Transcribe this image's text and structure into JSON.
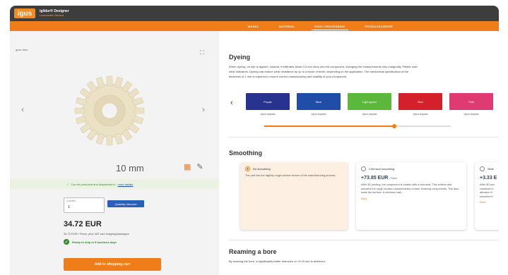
{
  "app": {
    "logo": "igus",
    "title": "iglidur® Designer",
    "subtitle": "Lasersinter-Service"
  },
  "nav": {
    "tabs": [
      {
        "label": "MODEL",
        "active": false
      },
      {
        "label": "MATERIAL",
        "active": false
      },
      {
        "label": "POST-PROCESSING",
        "active": true
      },
      {
        "label": "PRODUCE/ORDER",
        "active": false
      }
    ]
  },
  "viewer": {
    "label": "gear view",
    "size": "10 mm",
    "availability": "Can be produced and dispatched in",
    "availability_link": "more details"
  },
  "order": {
    "quantity_caption": "Quantity",
    "quantity": "1",
    "discount_button": "Quantity discount",
    "price": "34.72 EUR",
    "price_note": "34.72 EUR / Piece, plus VAT and shipping/packages",
    "ship": "Ready to ship in 5 business days",
    "cart_button": "Add to shopping cart"
  },
  "dyeing": {
    "heading": "Dyeing",
    "text_lines": [
      "When dyeing, no dye is applied. Instead, it infiltrates about 0.4 mm deep into the component, changing the measurements only marginally. Please note:",
      "wear indicators. Dyeing can reduce wear resistance by up to a factor of three, depending on the application. The mechanical specification of the",
      "thickness of 1 mm is required to ensure correct manufacturing and stability of your component."
    ],
    "colors": [
      {
        "name": "Purple",
        "price": "Upon request",
        "color": "#27338f"
      },
      {
        "name": "Blue",
        "price": "Upon request",
        "color": "#1f4da8"
      },
      {
        "name": "Light green",
        "price": "Upon request",
        "color": "#5cb83a"
      },
      {
        "name": "Red",
        "price": "Upon request",
        "color": "#d4202a"
      },
      {
        "name": "Pink",
        "price": "Upon request",
        "color": "#e03a72"
      }
    ],
    "slider_position": 0.7
  },
  "smoothing": {
    "heading": "Smoothing",
    "options": [
      {
        "title": "No smoothing",
        "selected": true,
        "price": "",
        "unit": "",
        "desc": "The part has the slightly rough surface texture of the manufacturing process.",
        "more": ""
      },
      {
        "title": "Chemical smoothing",
        "selected": false,
        "price": "+73.85 EUR",
        "unit": "/ Piece",
        "desc": "After 3D printing, the component is treated with a chemical. This softens and smooths the rough surface characteristics of laser sintering components. This also seals the surface. A minimum wall...",
        "more": "More"
      },
      {
        "title": "Slide",
        "selected": false,
        "price": "+3.33 E",
        "unit": "",
        "desc": "After 3D prin contained s abrasion ti smooths th",
        "more": "More"
      }
    ]
  },
  "reaming": {
    "heading": "Reaming a bore",
    "text": "By reaming the bore, a significantly better tolerance of +0.03 mm is achieved."
  },
  "colors": {
    "accent": "#ef7d1a",
    "header": "#3d3d3d",
    "link": "#2b5fb8",
    "success": "#2f8a26"
  }
}
